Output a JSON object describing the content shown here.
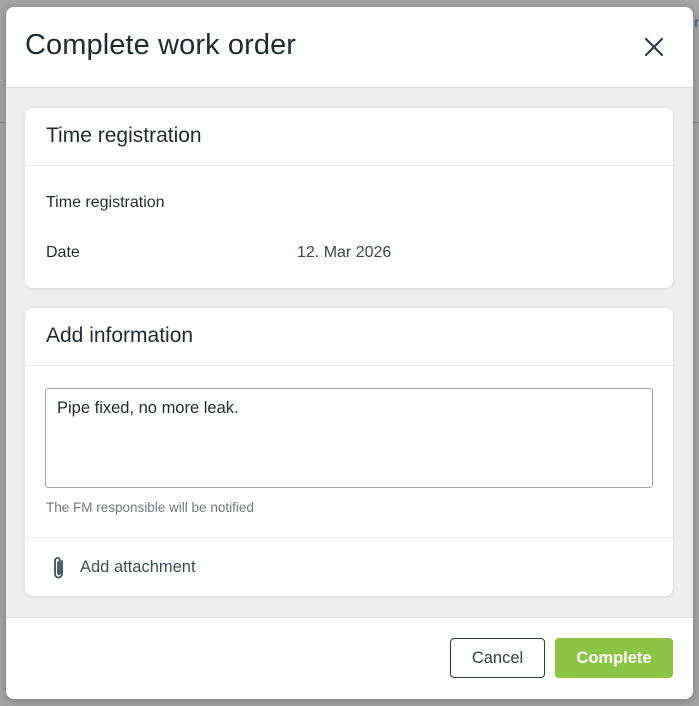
{
  "dialog": {
    "title": "Complete work order",
    "close_icon": "close-icon"
  },
  "background": {
    "peek_text": "r"
  },
  "time_card": {
    "header": "Time registration",
    "rows": [
      {
        "label": "Time registration",
        "value": ""
      },
      {
        "label": "Date",
        "value": "12. Mar 2026"
      }
    ]
  },
  "info_card": {
    "header": "Add information",
    "comment_value": "Pipe fixed, no more leak.",
    "hint": "The FM responsible will be notified",
    "attach_icon": "paperclip-icon",
    "attach_label": "Add attachment"
  },
  "footer": {
    "cancel_label": "Cancel",
    "complete_label": "Complete"
  },
  "colors": {
    "complete_button": "#8bc543",
    "text": "#1f2a33"
  }
}
